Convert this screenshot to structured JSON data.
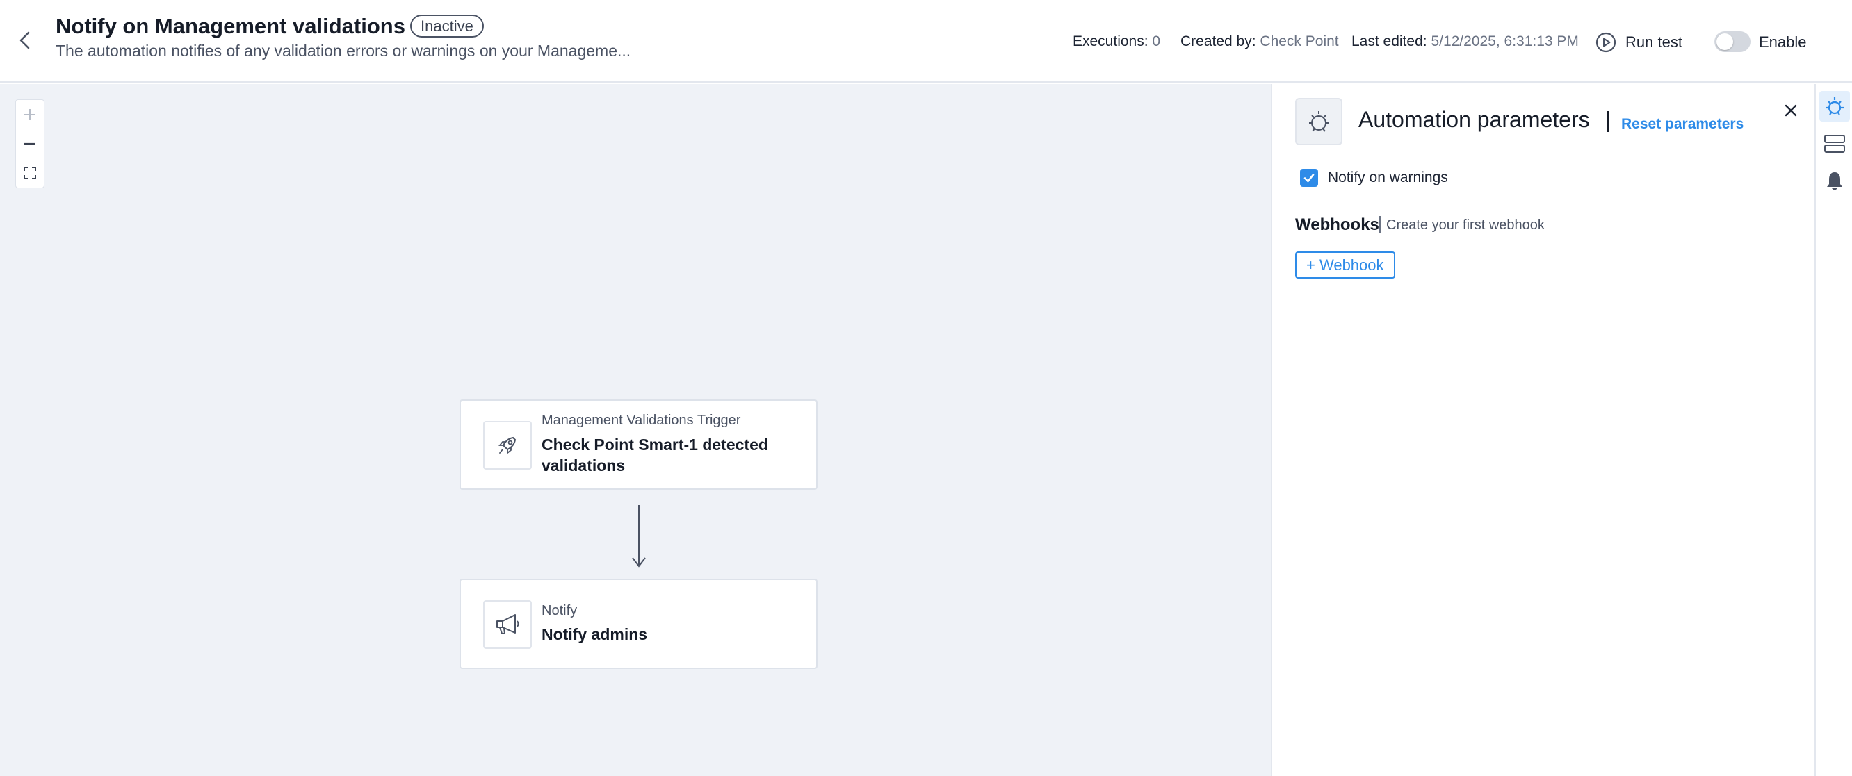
{
  "header": {
    "title": "Notify on Management validations",
    "status": "Inactive",
    "description": "The automation notifies of any validation errors or warnings on your Manageme...",
    "executions_label": "Executions:",
    "executions_value": "0",
    "created_label": "Created by:",
    "created_value": "Check Point",
    "edited_label": "Last edited:",
    "edited_value": "5/12/2025, 6:31:13 PM",
    "run_test_label": "Run test",
    "enable_label": "Enable",
    "enabled": false
  },
  "canvas": {
    "zoom_controls": [
      "zoom-in-icon",
      "zoom-out-icon",
      "fit-view-icon"
    ],
    "nodes": [
      {
        "type": "Management Validations Trigger",
        "title": "Check Point Smart-1 detected validations",
        "icon": "rocket-icon"
      },
      {
        "type": "Notify",
        "title": "Notify admins",
        "icon": "megaphone-icon"
      }
    ]
  },
  "panel": {
    "icon": "automation-gear-icon",
    "title": "Automation parameters",
    "reset_label": "Reset parameters",
    "notify_warnings_label": "Notify on warnings",
    "notify_warnings_checked": true,
    "webhooks_title": "Webhooks",
    "webhooks_hint": "Create your first webhook",
    "add_webhook_label": "+ Webhook"
  },
  "rail": {
    "items": [
      "automation-parameters-icon",
      "layers-icon",
      "bell-icon"
    ],
    "active": 0
  },
  "colors": {
    "accent": "#2e8be8",
    "canvas_bg": "#eff2f7",
    "text_primary": "#161c28",
    "text_muted": "#6b7384"
  }
}
